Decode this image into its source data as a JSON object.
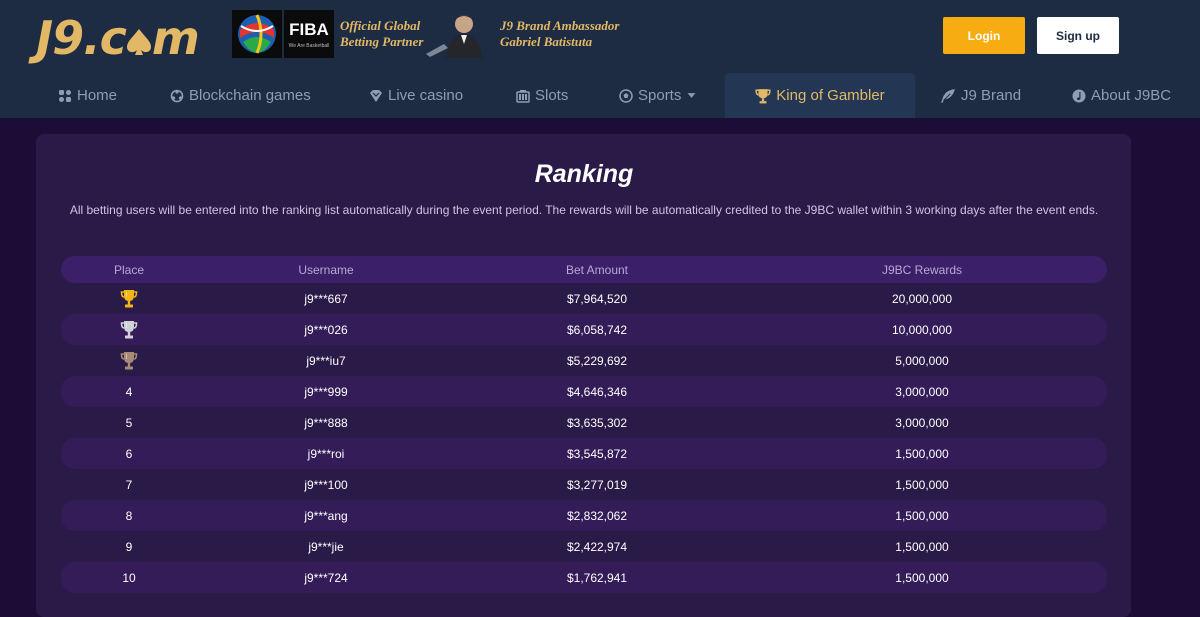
{
  "brand": {
    "logo_text_a": "J9.c",
    "logo_text_b": "m",
    "fiba_label": "FIBA",
    "fiba_sub": "We Are Basketball",
    "partner_line1": "Official Global",
    "partner_line2": "Betting Partner",
    "ambassador_line1": "J9 Brand Ambassador",
    "ambassador_line2": "Gabriel Batistuta"
  },
  "auth": {
    "login_label": "Login",
    "signup_label": "Sign up"
  },
  "nav": {
    "items": [
      {
        "label": "Home",
        "icon": "home-icon"
      },
      {
        "label": "Blockchain games",
        "icon": "blockchain-icon"
      },
      {
        "label": "Live casino",
        "icon": "casino-chip-icon"
      },
      {
        "label": "Slots",
        "icon": "slots-icon"
      },
      {
        "label": "Sports",
        "icon": "soccer-ball-icon"
      },
      {
        "label": "King of Gambler",
        "icon": "trophy-icon"
      },
      {
        "label": "J9 Brand",
        "icon": "feather-icon"
      },
      {
        "label": "About J9BC",
        "icon": "about-icon"
      }
    ],
    "active": "King of Gambler"
  },
  "ranking": {
    "title": "Ranking",
    "description": "All betting users will be entered into the ranking list automatically during the event period. The rewards will be automatically credited to the J9BC wallet within 3 working days after the event ends.",
    "columns": [
      "Place",
      "Username",
      "Bet Amount",
      "J9BC Rewards"
    ],
    "rows": [
      {
        "place": "",
        "medal": "gold",
        "username": "j9***667",
        "bet": "$7,964,520",
        "reward": "20,000,000"
      },
      {
        "place": "",
        "medal": "silver",
        "username": "j9***026",
        "bet": "$6,058,742",
        "reward": "10,000,000"
      },
      {
        "place": "",
        "medal": "bronze",
        "username": "j9***iu7",
        "bet": "$5,229,692",
        "reward": "5,000,000"
      },
      {
        "place": "4",
        "medal": "",
        "username": "j9***999",
        "bet": "$4,646,346",
        "reward": "3,000,000"
      },
      {
        "place": "5",
        "medal": "",
        "username": "j9***888",
        "bet": "$3,635,302",
        "reward": "3,000,000"
      },
      {
        "place": "6",
        "medal": "",
        "username": "j9***roi",
        "bet": "$3,545,872",
        "reward": "1,500,000"
      },
      {
        "place": "7",
        "medal": "",
        "username": "j9***100",
        "bet": "$3,277,019",
        "reward": "1,500,000"
      },
      {
        "place": "8",
        "medal": "",
        "username": "j9***ang",
        "bet": "$2,832,062",
        "reward": "1,500,000"
      },
      {
        "place": "9",
        "medal": "",
        "username": "j9***jie",
        "bet": "$2,422,974",
        "reward": "1,500,000"
      },
      {
        "place": "10",
        "medal": "",
        "username": "j9***724",
        "bet": "$1,762,941",
        "reward": "1,500,000"
      }
    ]
  },
  "colors": {
    "gold": "#e2b866",
    "login": "#f7ad12",
    "medal_gold": "#f2b619",
    "medal_silver": "#cfd3d8",
    "medal_bronze": "#a88a79"
  }
}
